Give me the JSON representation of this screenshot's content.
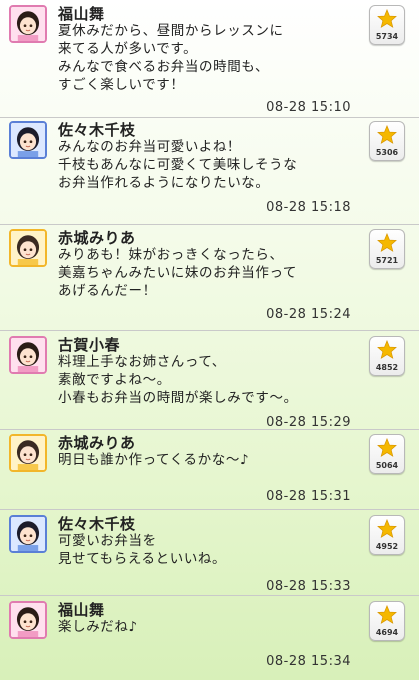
{
  "messages": [
    {
      "author": "福山舞",
      "lines": [
        "夏休みだから、昼間からレッスンに",
        "来てる人が多いです。",
        "みんなで食べるお弁当の時間も、",
        "すごく楽しいです！"
      ],
      "time": "08-28 15:10",
      "likes": "5734",
      "avatar_frame": "pink"
    },
    {
      "author": "佐々木千枝",
      "lines": [
        "みんなのお弁当可愛いよね！",
        "千枝もあんなに可愛くて美味しそうな",
        "お弁当作れるようになりたいな。"
      ],
      "time": "08-28 15:18",
      "likes": "5306",
      "avatar_frame": "blue"
    },
    {
      "author": "赤城みりあ",
      "lines": [
        "みりあも！妹がおっきくなったら、",
        "美嘉ちゃんみたいに妹のお弁当作って",
        "あげるんだー！"
      ],
      "time": "08-28 15:24",
      "likes": "5721",
      "avatar_frame": "yellow"
    },
    {
      "author": "古賀小春",
      "lines": [
        "料理上手なお姉さんって、",
        "素敵ですよね〜。",
        "小春もお弁当の時間が楽しみです〜。"
      ],
      "time": "08-28 15:29",
      "likes": "4852",
      "avatar_frame": "pink"
    },
    {
      "author": "赤城みりあ",
      "lines": [
        "明日も誰か作ってくるかな〜♪"
      ],
      "time": "08-28 15:31",
      "likes": "5064",
      "avatar_frame": "yellow"
    },
    {
      "author": "佐々木千枝",
      "lines": [
        "可愛いお弁当を",
        "見せてもらえるといいね。"
      ],
      "time": "08-28 15:33",
      "likes": "4952",
      "avatar_frame": "blue"
    },
    {
      "author": "福山舞",
      "lines": [
        "楽しみだね♪"
      ],
      "time": "08-28 15:34",
      "likes": "4694",
      "avatar_frame": "pink"
    }
  ],
  "colors": {
    "star": "#f5b800",
    "pink_frame": "#e07bb0",
    "blue_frame": "#5a7fd6",
    "yellow_frame": "#f2b62a"
  },
  "icons": {
    "like": "star-icon",
    "avatar": "idol-avatar-icon"
  }
}
